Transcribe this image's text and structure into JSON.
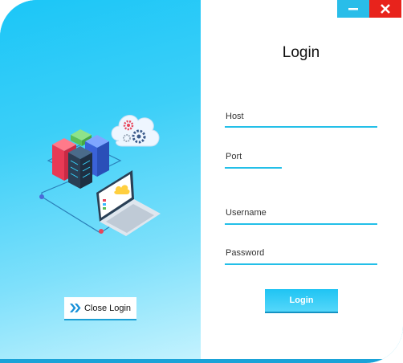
{
  "window": {
    "title": "Login",
    "minimize_icon": "minimize-icon",
    "close_icon": "close-icon"
  },
  "form": {
    "host_label": "Host",
    "port_label": "Port",
    "username_label": "Username",
    "password_label": "Password",
    "login_button": "Login"
  },
  "sidebar": {
    "close_login_label": "Close Login",
    "close_login_icon": "double-chevron-right-icon",
    "illustration": "server-cloud-laptop-illustration"
  },
  "colors": {
    "accent": "#23bfe8",
    "close_button": "#e8231c",
    "minimize_button": "#29bde9",
    "gradient_start": "#1bc6f7",
    "gradient_end": "#c6f3fe"
  }
}
